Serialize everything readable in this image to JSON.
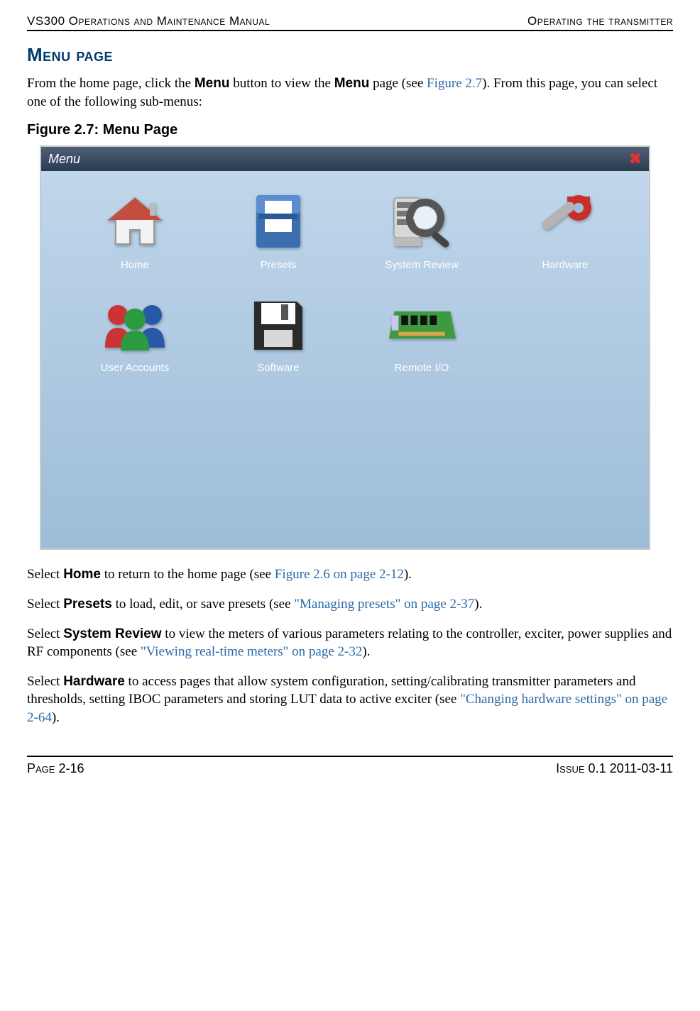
{
  "header": {
    "left": "VS300 Operations and Maintenance Manual",
    "right": "Operating the transmitter"
  },
  "section_heading": "Menu page",
  "intro": {
    "t1": "From the home page, click the ",
    "menu1": "Menu",
    "t2": " button to view the ",
    "menu2": "Menu",
    "t3": " page (see ",
    "figref": "Figure 2.7",
    "t4": "). From this page, you can select one of the following sub-menus:"
  },
  "figure_caption": "Figure 2.7: Menu Page",
  "menu_window": {
    "title": "Menu",
    "close": "✖",
    "items": [
      {
        "label": "Home"
      },
      {
        "label": "Presets"
      },
      {
        "label": "System Review"
      },
      {
        "label": "Hardware"
      },
      {
        "label": "User Accounts"
      },
      {
        "label": "Software"
      },
      {
        "label": "Remote I/O"
      }
    ]
  },
  "para_home": {
    "t1": "Select ",
    "b": "Home",
    "t2": " to return to the home page (see ",
    "link": "Figure 2.6 on page 2-12",
    "t3": ")."
  },
  "para_presets": {
    "t1": "Select ",
    "b": "Presets",
    "t2": " to load, edit, or save presets (see ",
    "link": "\"Managing presets\" on page 2-37",
    "t3": ")."
  },
  "para_sysreview": {
    "t1": "Select ",
    "b": "System Review",
    "t2": " to view the meters of various parameters relating to the controller, exciter, power supplies and RF components (see ",
    "link": "\"Viewing real-time meters\" on page 2-32",
    "t3": ")."
  },
  "para_hardware": {
    "t1": "Select ",
    "b": "Hardware",
    "t2": " to access pages that allow system configuration, setting/calibrating transmitter parameters and thresholds, setting IBOC parameters and storing LUT data to active exciter (see ",
    "link": "\"Changing hardware settings\" on page 2-64",
    "t3": ")."
  },
  "footer": {
    "page": "Page 2-16",
    "issue": "Issue 0.1  2011-03-11"
  }
}
